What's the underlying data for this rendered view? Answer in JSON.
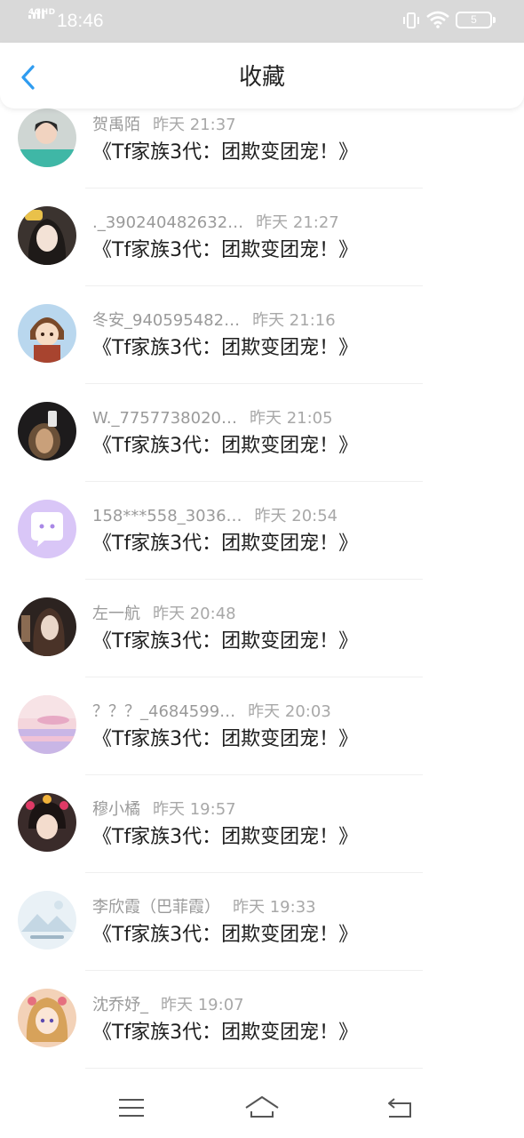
{
  "status_bar": {
    "network": "4GHD",
    "time": "18:46",
    "battery": "5",
    "icons": [
      "signal-icon",
      "vibrate-icon",
      "wifi-icon",
      "battery-icon"
    ]
  },
  "header": {
    "title": "收藏",
    "back_icon": "chevron-left-icon",
    "accent_color": "#2f9cf0"
  },
  "list": {
    "items": [
      {
        "user": "贺禹陌",
        "time": "昨天 21:37",
        "title": "《Tf家族3代：团欺变团宠！》"
      },
      {
        "user": "._390240482632…",
        "time": "昨天 21:27",
        "title": "《Tf家族3代：团欺变团宠！》"
      },
      {
        "user": "冬安_940595482…",
        "time": "昨天 21:16",
        "title": "《Tf家族3代：团欺变团宠！》"
      },
      {
        "user": "W._7757738020…",
        "time": "昨天 21:05",
        "title": "《Tf家族3代：团欺变团宠！》"
      },
      {
        "user": "158***558_3036…",
        "time": "昨天 20:54",
        "title": "《Tf家族3代：团欺变团宠！》"
      },
      {
        "user": "左一航",
        "time": "昨天 20:48",
        "title": "《Tf家族3代：团欺变团宠！》"
      },
      {
        "user": "？？？_4684599…",
        "time": "昨天 20:03",
        "title": "《Tf家族3代：团欺变团宠！》"
      },
      {
        "user": "穆小橘",
        "time": "昨天 19:57",
        "title": "《Tf家族3代：团欺变团宠！》"
      },
      {
        "user": "李欣霞（巴菲霞）",
        "time": "昨天 19:33",
        "title": "《Tf家族3代：团欺变团宠！》"
      },
      {
        "user": "沈乔妤_",
        "time": "昨天 19:07",
        "title": "《Tf家族3代：团欺变团宠！》"
      }
    ]
  },
  "bottom_nav": {
    "icons": [
      "menu-icon",
      "home-icon",
      "back-icon"
    ]
  }
}
